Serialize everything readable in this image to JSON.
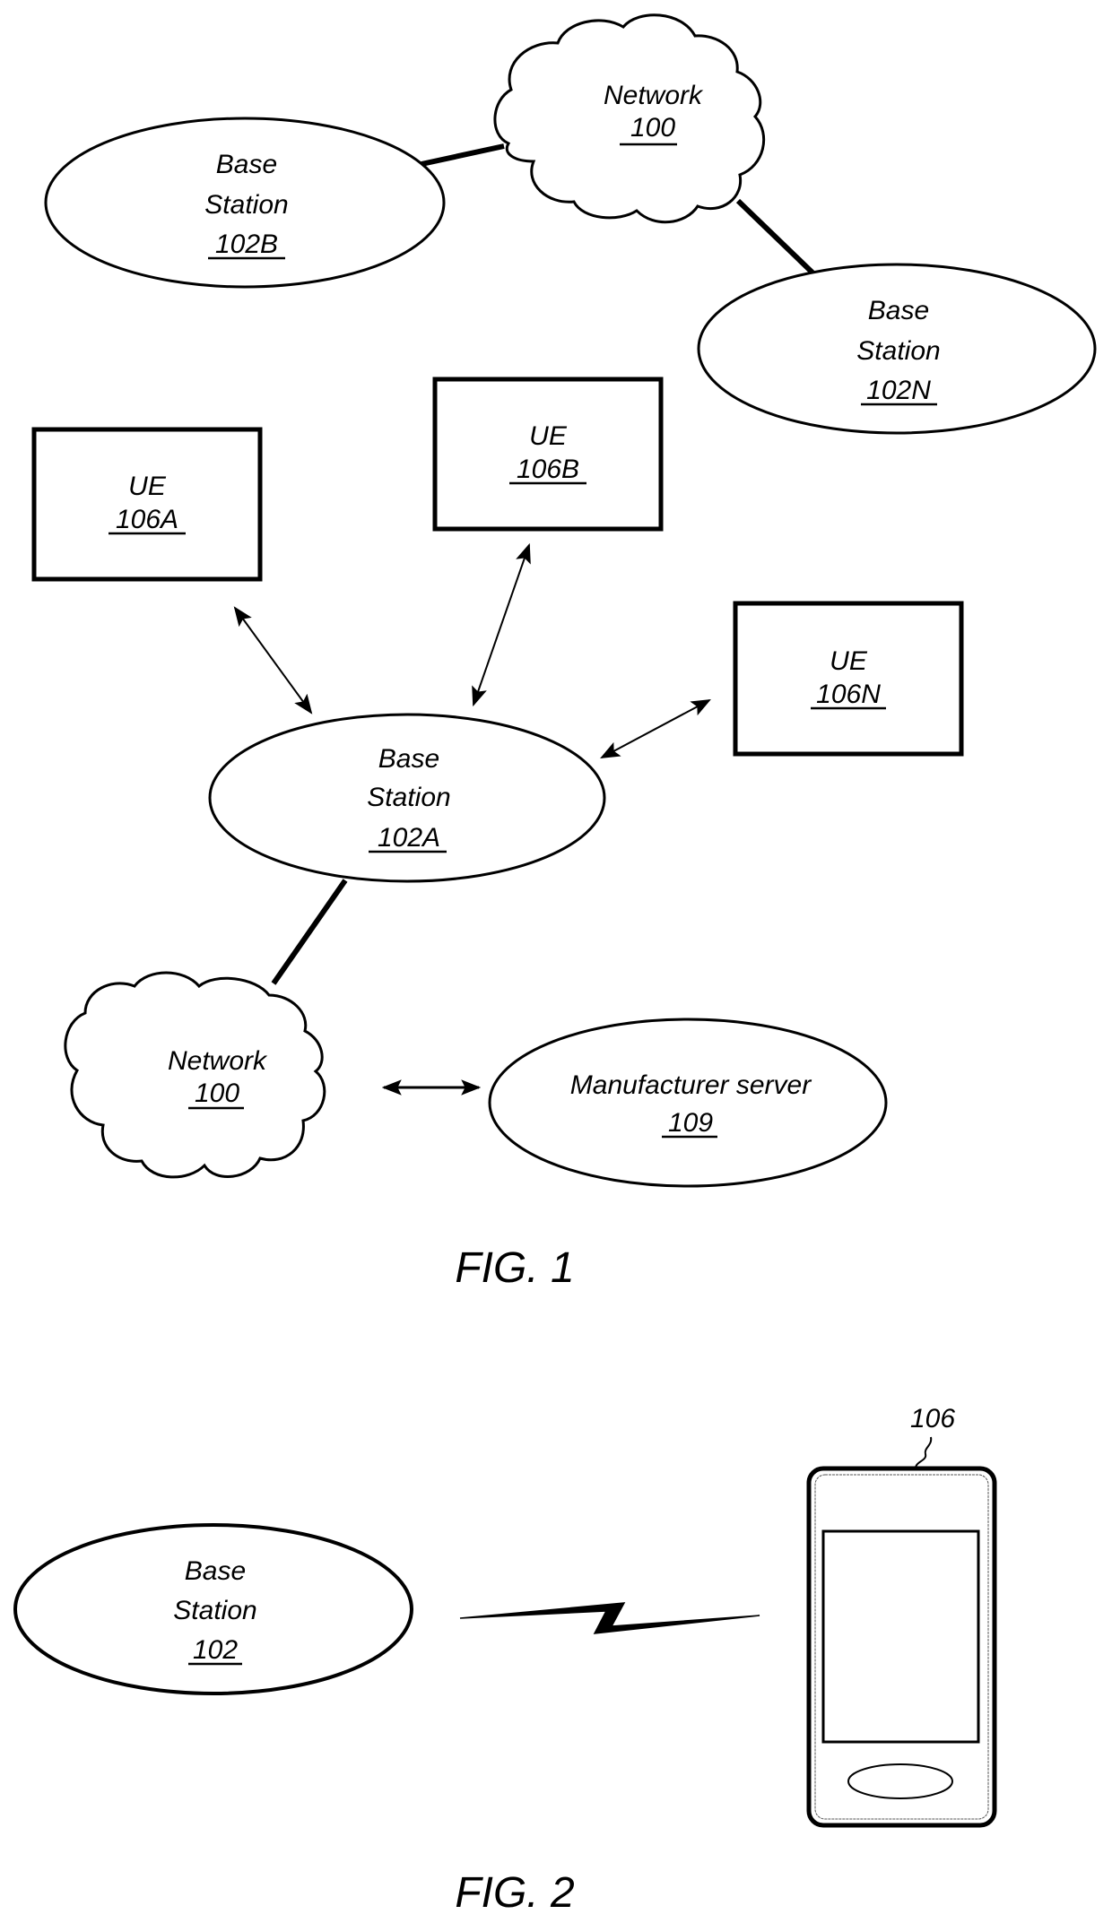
{
  "figure1": {
    "caption": "FIG. 1",
    "network_top": {
      "name": "Network",
      "ref": "100"
    },
    "base_station_b": {
      "line1": "Base",
      "line2": "Station",
      "ref": "102B"
    },
    "base_station_n": {
      "line1": "Base",
      "line2": "Station",
      "ref": "102N"
    },
    "base_station_a": {
      "line1": "Base",
      "line2": "Station",
      "ref": "102A"
    },
    "ue_a": {
      "name": "UE",
      "ref": "106A"
    },
    "ue_b": {
      "name": "UE",
      "ref": "106B"
    },
    "ue_n": {
      "name": "UE",
      "ref": "106N"
    },
    "network_bottom": {
      "name": "Network",
      "ref": "100"
    },
    "manufacturer_server": {
      "name": "Manufacturer server",
      "ref": "109"
    }
  },
  "figure2": {
    "caption": "FIG. 2",
    "base_station": {
      "line1": "Base",
      "line2": "Station",
      "ref": "102"
    },
    "device_ref": "106"
  }
}
